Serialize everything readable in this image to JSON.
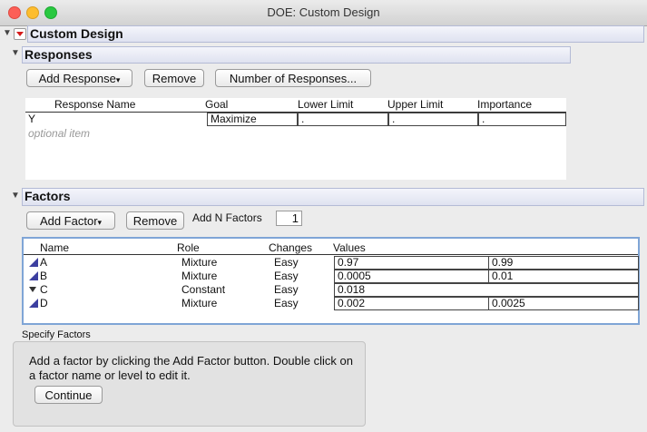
{
  "window": {
    "title": "DOE: Custom Design"
  },
  "custom_design": {
    "heading": "Custom Design"
  },
  "responses": {
    "heading": "Responses",
    "add_response_label": "Add Response",
    "remove_label": "Remove",
    "number_of_responses_label": "Number of Responses...",
    "columns": {
      "name": "Response Name",
      "goal": "Goal",
      "lower": "Lower Limit",
      "upper": "Upper Limit",
      "importance": "Importance"
    },
    "rows": [
      {
        "name": "Y",
        "goal": "Maximize",
        "lower": ".",
        "upper": ".",
        "importance": "."
      }
    ],
    "optional_placeholder": "optional item"
  },
  "factors": {
    "heading": "Factors",
    "add_factor_label": "Add Factor",
    "remove_label": "Remove",
    "add_n_factors_label": "Add N Factors",
    "add_n_factors_value": "1",
    "columns": {
      "name": "Name",
      "role": "Role",
      "changes": "Changes",
      "values": "Values"
    },
    "rows": [
      {
        "name": "A",
        "role": "Mixture",
        "changes": "Easy",
        "value1": "0.97",
        "value2": "0.99",
        "icon": "mixture-icon"
      },
      {
        "name": "B",
        "role": "Mixture",
        "changes": "Easy",
        "value1": "0.0005",
        "value2": "0.01",
        "icon": "mixture-icon"
      },
      {
        "name": "C",
        "role": "Constant",
        "changes": "Easy",
        "value1": "0.018",
        "value2": "",
        "icon": "constant-icon"
      },
      {
        "name": "D",
        "role": "Mixture",
        "changes": "Easy",
        "value1": "0.002",
        "value2": "0.0025",
        "icon": "mixture-icon"
      }
    ]
  },
  "specify_factors": {
    "label": "Specify Factors",
    "instructions": "Add a factor by clicking the Add Factor button. Double click on a factor name or level to edit it.",
    "continue_label": "Continue"
  }
}
